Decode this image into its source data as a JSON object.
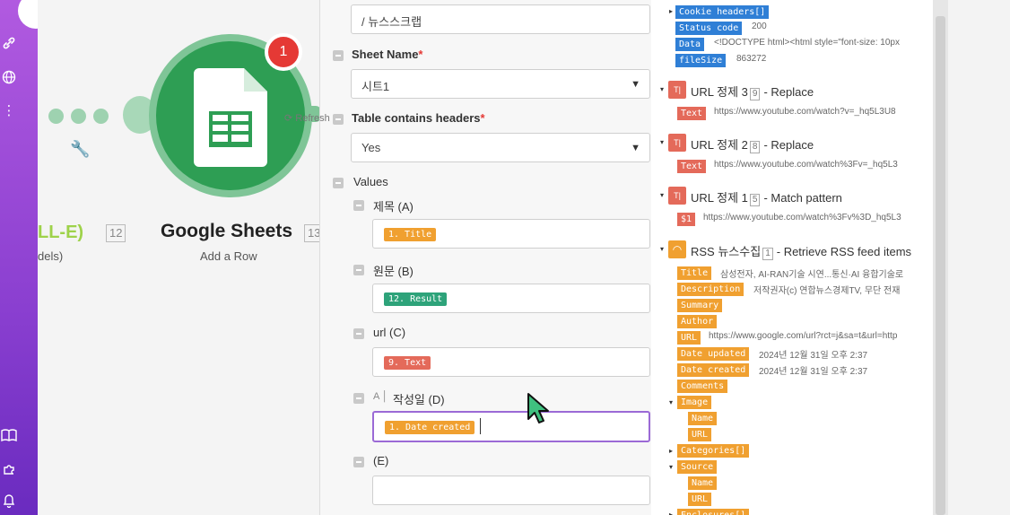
{
  "sidebar": {
    "icons": [
      "link-icon",
      "globe-icon",
      "more-vertical-icon",
      "book-icon",
      "puzzle-icon",
      "bell-icon"
    ]
  },
  "canvas": {
    "left_node": {
      "title": "LL-E)",
      "sub": "dels)",
      "number": "12"
    },
    "main_node": {
      "title": "Google Sheets",
      "sub": "Add a Row",
      "number": "13",
      "badge": "1"
    }
  },
  "form": {
    "path_value": "/ 뉴스스크랩",
    "sheet_name_label": "Sheet Name",
    "sheet_name_value": "시트1",
    "table_headers_label": "Table contains headers",
    "table_headers_value": "Yes",
    "refresh_label": "Refresh",
    "values_label": "Values",
    "required_mark": "*",
    "columns": [
      {
        "label": "제목 (A)",
        "tag": "1. Title"
      },
      {
        "label": "원문 (B)",
        "tag": "12. Result"
      },
      {
        "label": "url (C)",
        "tag": "9. Text"
      },
      {
        "label": "작성일 (D)",
        "tag": "1. Date created"
      },
      {
        "label": "(E)",
        "tag": ""
      }
    ],
    "a_icon": "A"
  },
  "data_panel": {
    "http": [
      {
        "key": "Cookie headers[]",
        "value": ""
      },
      {
        "key": "Status code",
        "value": "200"
      },
      {
        "key": "Data",
        "value": "<!DOCTYPE html><html style=\"font-size: 10px"
      },
      {
        "key": "fileSize",
        "value": "863272"
      }
    ],
    "modules": [
      {
        "name": "URL 정제 3",
        "num": "9",
        "action": "- Replace",
        "key": "Text",
        "value": "https://www.youtube.com/watch?v=_hq5L3U8"
      },
      {
        "name": "URL 정제 2",
        "num": "8",
        "action": "- Replace",
        "key": "Text",
        "value": "https://www.youtube.com/watch%3Fv=_hq5L3"
      },
      {
        "name": "URL 정제 1",
        "num": "5",
        "action": "- Match pattern",
        "key": "$1",
        "value": "https://www.youtube.com/watch%3Fv%3D_hq5L3"
      }
    ],
    "rss": {
      "name": "RSS 뉴스수집",
      "num": "1",
      "action": "- Retrieve RSS feed items",
      "fields": [
        {
          "key": "Title",
          "value": "삼성전자, AI-RAN기술 시연...통신·AI 융합기술로"
        },
        {
          "key": "Description",
          "value": "저작권자(c) 연합뉴스경제TV, 무단 전재"
        },
        {
          "key": "Summary",
          "value": ""
        },
        {
          "key": "Author",
          "value": ""
        },
        {
          "key": "URL",
          "value": "https://www.google.com/url?rct=j&sa=t&url=http"
        },
        {
          "key": "Date updated",
          "value": "2024년 12월 31일 오후 2:37"
        },
        {
          "key": "Date created",
          "value": "2024년 12월 31일 오후 2:37"
        },
        {
          "key": "Comments",
          "value": ""
        },
        {
          "key": "Image",
          "value": ""
        },
        {
          "key": "Name",
          "value": ""
        },
        {
          "key": "URL",
          "value": ""
        },
        {
          "key": "Categories[]",
          "value": ""
        },
        {
          "key": "Source",
          "value": ""
        },
        {
          "key": "Name",
          "value": ""
        },
        {
          "key": "URL",
          "value": ""
        },
        {
          "key": "Enclosures[]",
          "value": ""
        }
      ]
    }
  }
}
